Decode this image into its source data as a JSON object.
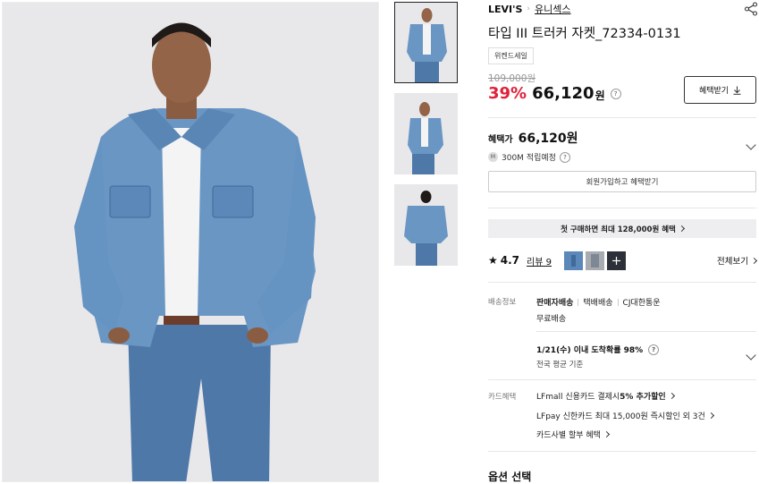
{
  "product": {
    "brand": "LEVI'S",
    "category": "유니섹스",
    "title": "타입 III 트러커 자켓_72334-0131",
    "tag": "위켄드세일",
    "original_price": "109,000원",
    "discount_pct": "39%",
    "sale_price": "66,120",
    "won": "원"
  },
  "actions": {
    "benefit_button": "혜택받기",
    "join_button": "회원가입하고 혜택받기"
  },
  "benefit": {
    "label": "혜택가",
    "price": "66,120원",
    "points_coin": "M",
    "points": "300M 적립예정",
    "first_buy": "첫 구매하면 최대 128,000원 혜택"
  },
  "reviews": {
    "rating": "4.7",
    "count_label": "리뷰 9",
    "view_all": "전체보기"
  },
  "shipping": {
    "label": "배송정보",
    "methods": [
      "판매자배송",
      "택배배송",
      "CJ대한통운"
    ],
    "free": "무료배송",
    "arrival": "1/21(수) 이내 도착확률 98%",
    "arrival_sub": "전국 평균 기준"
  },
  "card": {
    "label": "카드혜택",
    "lines": [
      {
        "pre": "LFmall 신용카드 결제시 ",
        "bold": "5% 추가할인"
      },
      {
        "pre": "LFpay 신한카드 최대 15,000원 즉시할인 외 3건",
        "bold": ""
      },
      {
        "pre": "카드사별 할부 혜택",
        "bold": ""
      }
    ]
  },
  "option_title": "옵션 선택",
  "colors": {
    "discount": "#e0213a",
    "denim": "#5b88b8",
    "background": "#e9e9eb"
  }
}
